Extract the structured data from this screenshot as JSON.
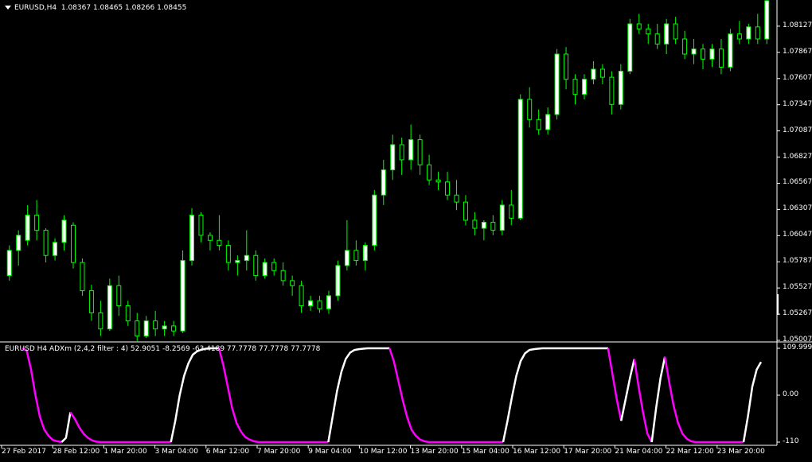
{
  "main_pane": {
    "symbol": "EURUSD,H4",
    "ohlc": "1.08367 1.08465 1.08266 1.08455",
    "price_levels": [
      "1.08127",
      "1.07867",
      "1.07607",
      "1.07347",
      "1.07087",
      "1.06827",
      "1.06567",
      "1.06307",
      "1.06047",
      "1.05787",
      "1.05527",
      "1.05267",
      "1.05007"
    ]
  },
  "indicator_pane": {
    "label": "EURUSD H4 ADXm (2,4,2 filter : 4) 52.9051 -8.2569 -63.4189 77.7778 77.7778 77.7778",
    "levels": [
      "109.9998",
      "0.00",
      "-110"
    ]
  },
  "time_axis": [
    "27 Feb 2017",
    "28 Feb 12:00",
    "1 Mar 20:00",
    "3 Mar 04:00",
    "6 Mar 12:00",
    "7 Mar 20:00",
    "9 Mar 04:00",
    "10 Mar 12:00",
    "13 Mar 20:00",
    "15 Mar 04:00",
    "16 Mar 12:00",
    "17 Mar 20:00",
    "21 Mar 04:00",
    "22 Mar 12:00",
    "23 Mar 20:00"
  ],
  "colors": {
    "background": "#000000",
    "bull_candle": "#ffffff",
    "bear_candle": "#000000",
    "candle_wick": "#00ff00",
    "indicator_up": "#ffffff",
    "indicator_down": "#ff00ff",
    "frame": "#ffffff"
  },
  "chart_data": {
    "type": "candlestick",
    "symbol": "EURUSD",
    "timeframe": "H4",
    "ylim": [
      1.05007,
      1.08387
    ],
    "candles": [
      [
        1.0565,
        1.0595,
        1.056,
        1.059
      ],
      [
        1.059,
        1.061,
        1.0575,
        1.0605
      ],
      [
        1.06,
        1.0635,
        1.0595,
        1.0625
      ],
      [
        1.0625,
        1.064,
        1.06,
        1.061
      ],
      [
        1.061,
        1.0612,
        1.0578,
        1.0585
      ],
      [
        1.0585,
        1.0602,
        1.058,
        1.0598
      ],
      [
        1.0598,
        1.0625,
        1.059,
        1.062
      ],
      [
        1.0615,
        1.0618,
        1.0572,
        1.0578
      ],
      [
        1.0578,
        1.0582,
        1.0545,
        1.055
      ],
      [
        1.055,
        1.0556,
        1.052,
        1.0528
      ],
      [
        1.0528,
        1.054,
        1.0505,
        1.0512
      ],
      [
        1.0512,
        1.0562,
        1.051,
        1.0555
      ],
      [
        1.0555,
        1.0565,
        1.0525,
        1.0535
      ],
      [
        1.0535,
        1.054,
        1.0515,
        1.052
      ],
      [
        1.052,
        1.0528,
        1.05,
        1.0505
      ],
      [
        1.0505,
        1.0525,
        1.0503,
        1.052
      ],
      [
        1.052,
        1.053,
        1.0505,
        1.0512
      ],
      [
        1.0512,
        1.052,
        1.0505,
        1.0515
      ],
      [
        1.0515,
        1.052,
        1.0505,
        1.051
      ],
      [
        1.051,
        1.059,
        1.0508,
        1.058
      ],
      [
        1.058,
        1.0632,
        1.0575,
        1.0625
      ],
      [
        1.0625,
        1.0628,
        1.0598,
        1.0605
      ],
      [
        1.0605,
        1.0608,
        1.059,
        1.06
      ],
      [
        1.06,
        1.0625,
        1.059,
        1.0595
      ],
      [
        1.0595,
        1.06,
        1.057,
        1.0578
      ],
      [
        1.0578,
        1.0585,
        1.0565,
        1.058
      ],
      [
        1.058,
        1.061,
        1.057,
        1.0585
      ],
      [
        1.0585,
        1.059,
        1.056,
        1.0565
      ],
      [
        1.0565,
        1.0582,
        1.0562,
        1.0578
      ],
      [
        1.0578,
        1.0582,
        1.0565,
        1.057
      ],
      [
        1.057,
        1.0578,
        1.0555,
        1.056
      ],
      [
        1.056,
        1.0565,
        1.0545,
        1.0555
      ],
      [
        1.0555,
        1.056,
        1.0528,
        1.0535
      ],
      [
        1.0535,
        1.0545,
        1.053,
        1.054
      ],
      [
        1.054,
        1.0545,
        1.0528,
        1.0532
      ],
      [
        1.0532,
        1.055,
        1.0527,
        1.0545
      ],
      [
        1.0545,
        1.058,
        1.054,
        1.0575
      ],
      [
        1.0575,
        1.062,
        1.057,
        1.059
      ],
      [
        1.059,
        1.06,
        1.0575,
        1.058
      ],
      [
        1.058,
        1.0598,
        1.057,
        1.0595
      ],
      [
        1.0595,
        1.065,
        1.059,
        1.0645
      ],
      [
        1.0645,
        1.068,
        1.0635,
        1.067
      ],
      [
        1.067,
        1.0705,
        1.066,
        1.0695
      ],
      [
        1.0695,
        1.0702,
        1.0665,
        1.068
      ],
      [
        1.068,
        1.0715,
        1.067,
        1.07
      ],
      [
        1.07,
        1.0705,
        1.0665,
        1.0675
      ],
      [
        1.0675,
        1.0685,
        1.0655,
        1.066
      ],
      [
        1.066,
        1.0668,
        1.065,
        1.0658
      ],
      [
        1.0658,
        1.0668,
        1.064,
        1.0645
      ],
      [
        1.0645,
        1.066,
        1.063,
        1.0638
      ],
      [
        1.0638,
        1.0645,
        1.0615,
        1.062
      ],
      [
        1.062,
        1.0628,
        1.0605,
        1.0612
      ],
      [
        1.0612,
        1.062,
        1.06,
        1.0618
      ],
      [
        1.0618,
        1.0625,
        1.0605,
        1.061
      ],
      [
        1.061,
        1.064,
        1.0605,
        1.0635
      ],
      [
        1.0635,
        1.065,
        1.0615,
        1.0622
      ],
      [
        1.0622,
        1.0745,
        1.062,
        1.074
      ],
      [
        1.074,
        1.0752,
        1.0712,
        1.072
      ],
      [
        1.072,
        1.073,
        1.0705,
        1.071
      ],
      [
        1.071,
        1.0732,
        1.0705,
        1.0725
      ],
      [
        1.0725,
        1.079,
        1.072,
        1.0785
      ],
      [
        1.0785,
        1.0792,
        1.075,
        1.076
      ],
      [
        1.076,
        1.0765,
        1.0735,
        1.0745
      ],
      [
        1.0745,
        1.0765,
        1.074,
        1.076
      ],
      [
        1.076,
        1.0778,
        1.0755,
        1.077
      ],
      [
        1.077,
        1.0775,
        1.0755,
        1.0762
      ],
      [
        1.0762,
        1.0768,
        1.0725,
        1.0735
      ],
      [
        1.0735,
        1.0775,
        1.073,
        1.0768
      ],
      [
        1.0768,
        1.082,
        1.0765,
        1.0815
      ],
      [
        1.0815,
        1.0825,
        1.0805,
        1.081
      ],
      [
        1.081,
        1.0815,
        1.0795,
        1.0805
      ],
      [
        1.0805,
        1.0815,
        1.079,
        1.0795
      ],
      [
        1.0795,
        1.082,
        1.0785,
        1.0815
      ],
      [
        1.0815,
        1.0822,
        1.0795,
        1.08
      ],
      [
        1.08,
        1.0808,
        1.078,
        1.0785
      ],
      [
        1.0785,
        1.08,
        1.0775,
        1.079
      ],
      [
        1.079,
        1.0795,
        1.077,
        1.078
      ],
      [
        1.078,
        1.0795,
        1.0772,
        1.079
      ],
      [
        1.079,
        1.08,
        1.0765,
        1.0772
      ],
      [
        1.0772,
        1.081,
        1.0768,
        1.0805
      ],
      [
        1.0805,
        1.0818,
        1.0795,
        1.08
      ],
      [
        1.08,
        1.0815,
        1.0795,
        1.0812
      ],
      [
        1.0812,
        1.0825,
        1.0795,
        1.08
      ],
      [
        1.08,
        1.084,
        1.0795,
        1.0838
      ]
    ],
    "indicator": {
      "name": "ADXm",
      "ylim": [
        -110,
        109.9998
      ],
      "segments": [
        {
          "color": "down",
          "values": [
            110,
            105,
            60,
            0,
            -50,
            -80,
            -95,
            -105,
            -108,
            -110
          ]
        },
        {
          "color": "up",
          "values": [
            -110,
            -100,
            -40
          ]
        },
        {
          "color": "down",
          "values": [
            -40,
            -55,
            -75,
            -90,
            -100,
            -106,
            -109,
            -110,
            -110,
            -110,
            -110,
            -110,
            -110,
            -110,
            -110,
            -110,
            -110,
            -110,
            -110,
            -110,
            -110,
            -110,
            -110,
            -110
          ]
        },
        {
          "color": "up",
          "values": [
            -110,
            -60,
            0,
            45,
            75,
            95,
            103,
            107,
            109,
            110,
            110,
            110
          ]
        },
        {
          "color": "down",
          "values": [
            110,
            70,
            20,
            -30,
            -65,
            -85,
            -98,
            -104,
            -108,
            -110,
            -110,
            -110,
            -110,
            -110,
            -110,
            -110,
            -110,
            -110,
            -110,
            -110,
            -110,
            -110,
            -110,
            -110,
            -110,
            -110
          ]
        },
        {
          "color": "up",
          "values": [
            -110,
            -50,
            10,
            55,
            85,
            100,
            106,
            108,
            109,
            110,
            110,
            110,
            110,
            110,
            110
          ]
        },
        {
          "color": "down",
          "values": [
            110,
            80,
            35,
            -10,
            -50,
            -80,
            -95,
            -104,
            -108,
            -110,
            -110,
            -110,
            -110,
            -110,
            -110,
            -110,
            -110,
            -110,
            -110,
            -110,
            -110,
            -110,
            -110,
            -110,
            -110,
            -110,
            -110
          ]
        },
        {
          "color": "up",
          "values": [
            -110,
            -60,
            -5,
            45,
            80,
            98,
            106,
            108,
            109,
            110,
            110,
            110,
            110,
            110,
            110,
            110,
            110,
            110,
            110,
            110,
            110,
            110,
            110,
            110,
            110
          ]
        },
        {
          "color": "down",
          "values": [
            110,
            50,
            -10,
            -60
          ]
        },
        {
          "color": "up",
          "values": [
            -60,
            -10,
            40,
            85
          ]
        },
        {
          "color": "down",
          "values": [
            85,
            20,
            -40,
            -90,
            -110
          ]
        },
        {
          "color": "up",
          "values": [
            -110,
            -30,
            40,
            90
          ]
        },
        {
          "color": "down",
          "values": [
            90,
            30,
            -25,
            -65,
            -90,
            -102,
            -108,
            -110,
            -110,
            -110,
            -110,
            -110,
            -110,
            -110,
            -110,
            -110,
            -110,
            -110,
            -110
          ]
        },
        {
          "color": "up",
          "values": [
            -110,
            -50,
            20,
            60,
            78
          ]
        }
      ]
    }
  }
}
